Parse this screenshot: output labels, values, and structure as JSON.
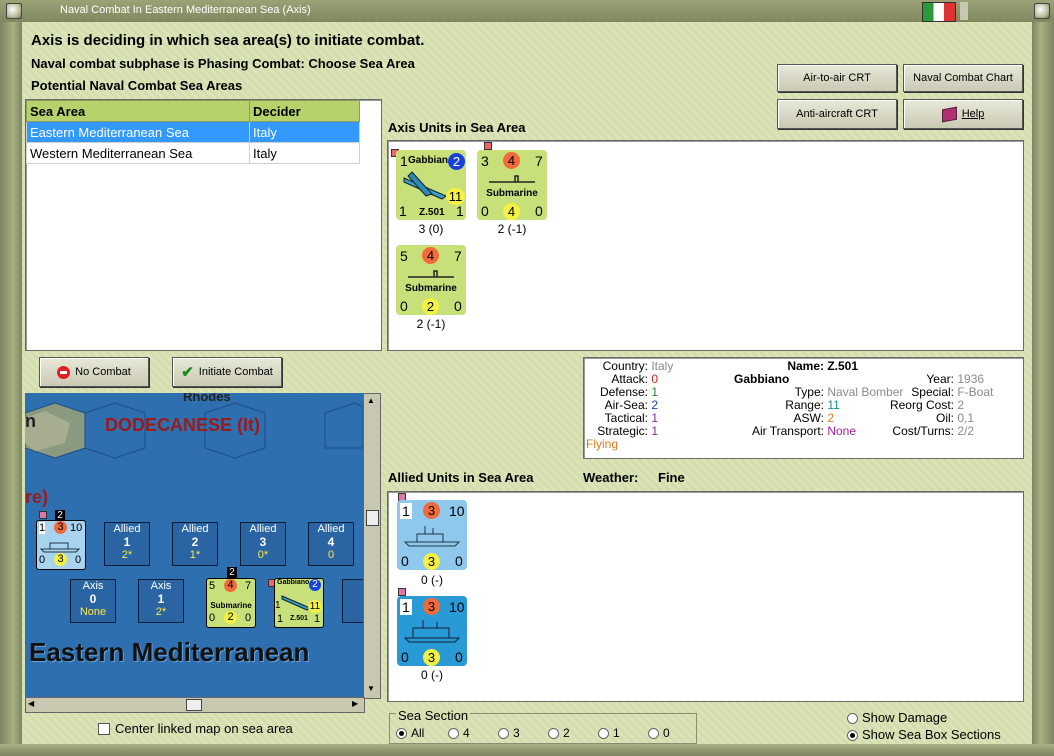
{
  "window": {
    "title": "Naval Combat In Eastern Mediterranean Sea (Axis)"
  },
  "header": {
    "line1": "Axis is deciding in which sea area(s) to initiate combat.",
    "line2": "Naval combat subphase is Phasing Combat: Choose Sea Area",
    "line3": "Potential Naval Combat Sea Areas"
  },
  "buttons": {
    "air_to_air": "Air-to-air CRT",
    "naval_chart": "Naval Combat Chart",
    "anti_aircraft": "Anti-aircraft CRT",
    "help": "Help",
    "no_combat": "No Combat",
    "initiate": "Initiate Combat"
  },
  "sea_table": {
    "headers": [
      "Sea Area",
      "Decider"
    ],
    "rows": [
      {
        "area": "Eastern Mediterranean Sea",
        "decider": "Italy"
      },
      {
        "area": "Western Mediterranean Sea",
        "decider": "Italy"
      }
    ]
  },
  "axis_units": {
    "title": "Axis Units in Sea Area",
    "units": [
      {
        "name": "Gabbiano",
        "model": "Z.501",
        "tl": "1",
        "badge": "2",
        "big": "11",
        "bl": "1",
        "br": "1",
        "caption": "3 (0)"
      },
      {
        "name": "Submarine",
        "tl": "3",
        "tc": "4",
        "tr": "7",
        "bl": "0",
        "bc": "4",
        "br": "0",
        "caption": "2 (-1)"
      },
      {
        "name": "Submarine",
        "tl": "5",
        "tc": "4",
        "tr": "7",
        "bl": "0",
        "bc": "2",
        "br": "0",
        "caption": "2 (-1)"
      }
    ]
  },
  "info": {
    "country_k": "Country:",
    "country_v": "Italy",
    "attack_k": "Attack:",
    "attack_v": "0",
    "defense_k": "Defense:",
    "defense_v": "1",
    "airsea_k": "Air-Sea:",
    "airsea_v": "2",
    "tactical_k": "Tactical:",
    "tactical_v": "1",
    "strategic_k": "Strategic:",
    "strategic_v": "1",
    "flying": "Flying",
    "name_k": "Name:",
    "name_v": "Z.501 Gabbiano",
    "type_k": "Type:",
    "type_v": "Naval Bomber",
    "range_k": "Range:",
    "range_v": "11",
    "asw_k": "ASW:",
    "asw_v": "2",
    "airtrans_k": "Air Transport:",
    "airtrans_v": "None",
    "year_k": "Year:",
    "year_v": "1936",
    "special_k": "Special:",
    "special_v": "F-Boat",
    "reorg_k": "Reorg Cost:",
    "reorg_v": "2",
    "oil_k": "Oil:",
    "oil_v": "0,1",
    "cost_k": "Cost/Turns:",
    "cost_v": "2/2"
  },
  "allied_units": {
    "title": "Allied Units in Sea Area",
    "weather_label": "Weather:",
    "weather_value": "Fine",
    "units": [
      {
        "tl": "1",
        "tc": "3",
        "tr": "10",
        "bl": "0",
        "bc": "3",
        "br": "0",
        "caption": "0 (-)"
      },
      {
        "tl": "1",
        "tc": "3",
        "tr": "10",
        "bl": "0",
        "bc": "3",
        "br": "0",
        "caption": "0 (-)"
      }
    ]
  },
  "map": {
    "rhodes": "Rhodes",
    "dodecanese": "DODECANESE (It)",
    "partial_n": "n",
    "partial_re": "re)",
    "sea_name": "Eastern Mediterranean",
    "allied_boxes": [
      {
        "label": "Allied",
        "num": "1",
        "sub": "2*"
      },
      {
        "label": "Allied",
        "num": "2",
        "sub": "1*"
      },
      {
        "label": "Allied",
        "num": "3",
        "sub": "0*"
      },
      {
        "label": "Allied",
        "num": "4",
        "sub": "0"
      }
    ],
    "axis_boxes": [
      {
        "label": "Axis",
        "num": "0",
        "sub": "None"
      },
      {
        "label": "Axis",
        "num": "1",
        "sub": "2*"
      }
    ],
    "stack_a": "2",
    "stack_b": "2",
    "mini_ship": {
      "tl": "1",
      "tc": "3",
      "tr": "10",
      "bl": "0",
      "bc": "3",
      "br": "0"
    },
    "mini_sub": {
      "tl": "5",
      "tc": "4",
      "tr": "7",
      "name": "Submarine",
      "bl": "0",
      "bc": "2",
      "br": "0"
    },
    "mini_plane": {
      "name": "Gabbiano",
      "badge": "2",
      "big": "11",
      "tl": "1",
      "bl": "1",
      "model": "Z.501",
      "br": "1"
    }
  },
  "center_map_label": "Center linked map on sea area",
  "sea_section": {
    "label": "Sea Section",
    "options": [
      "All",
      "4",
      "3",
      "2",
      "1",
      "0"
    ],
    "selected": "All"
  },
  "show_damage": "Show Damage",
  "show_boxes": "Show Sea Box Sections"
}
